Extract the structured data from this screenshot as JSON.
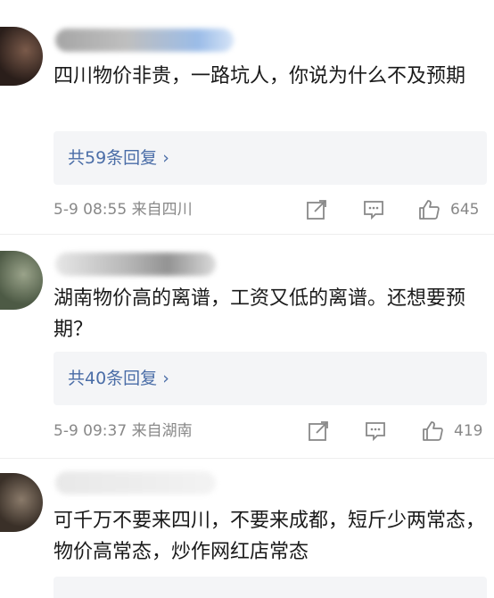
{
  "comments": [
    {
      "text": "四川物价非贵，一路坑人，你说为什么不及预期",
      "replies_label": "共59条回复 ›",
      "time": "5-9 08:55",
      "source": "来自四川",
      "likes": "645"
    },
    {
      "text": "湖南物价高的离谱，工资又低的离谱。还想要预期？",
      "replies_label": "共40条回复 ›",
      "time": "5-9 09:37",
      "source": "来自湖南",
      "likes": "419"
    },
    {
      "text": "可千万不要来四川，不要来成都，短斤少两常态，物价高常态，炒作网红店常态"
    }
  ],
  "icons": {
    "share": "share-icon",
    "comment": "comment-icon",
    "like": "thumbs-up-icon"
  },
  "colors": {
    "link": "#4a6da7",
    "meta": "#888888",
    "reply_bg": "#f4f5f7"
  }
}
